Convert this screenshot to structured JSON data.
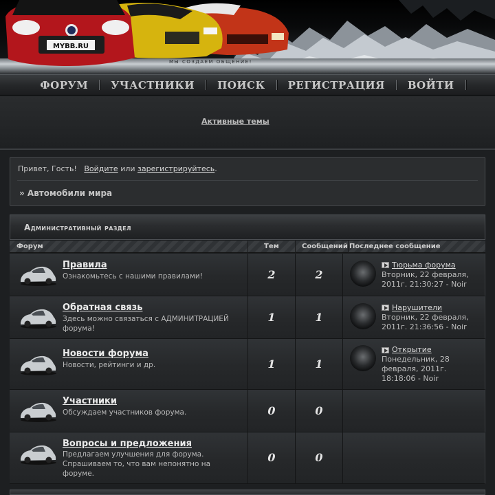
{
  "header": {
    "logo_text": "MYBB.RU",
    "slogan": "МЫ СОЗДАЕМ ОБЩЕНИЕ!"
  },
  "nav": {
    "items": [
      {
        "label": "ФОРУМ"
      },
      {
        "label": "УЧАСТНИКИ"
      },
      {
        "label": "ПОИСК"
      },
      {
        "label": "РЕГИСТРАЦИЯ"
      },
      {
        "label": "ВОЙТИ"
      }
    ]
  },
  "active_topics": "Активные темы",
  "welcome": {
    "greeting": "Привет, Гость!",
    "login_link": "Войдите",
    "or": "или",
    "register_link": "зарегистрируйтесь",
    "period": "."
  },
  "breadcrumb": "» Автомобили мира",
  "category": {
    "title": "Административный раздел"
  },
  "columns": {
    "forum": "Форум",
    "topics": "Тем",
    "posts": "Сообщений",
    "last_post": "Последнее сообщение"
  },
  "forums": [
    {
      "title": "Правила",
      "desc": "Ознакомьтесь с нашими правилами!",
      "topics": "2",
      "posts": "2",
      "last_topic": "Тюрьма форума",
      "last_meta": "Вторник, 22 февраля, 2011г. 21:30:27 - Noir"
    },
    {
      "title": "Обратная связь",
      "desc": "Здесь можно связаться с АДМИНИТРАЦИЕЙ форума!",
      "topics": "1",
      "posts": "1",
      "last_topic": "Нарушители",
      "last_meta": "Вторник, 22 февраля, 2011г. 21:36:56 - Noir"
    },
    {
      "title": "Новости форума",
      "desc": "Новости, рейтинги и др.",
      "topics": "1",
      "posts": "1",
      "last_topic": "Открытие",
      "last_meta": "Понедельник, 28 февраля, 2011г. 18:18:06 - Noir"
    },
    {
      "title": "Участники",
      "desc": "Обсуждаем участников форума.",
      "topics": "0",
      "posts": "0",
      "last_topic": "",
      "last_meta": ""
    },
    {
      "title": "Вопросы и предложения",
      "desc": "Предлагаем улучшения для форума. Спрашиваем то, что вам непонятно на форуме.",
      "topics": "0",
      "posts": "0",
      "last_topic": "",
      "last_meta": ""
    }
  ]
}
